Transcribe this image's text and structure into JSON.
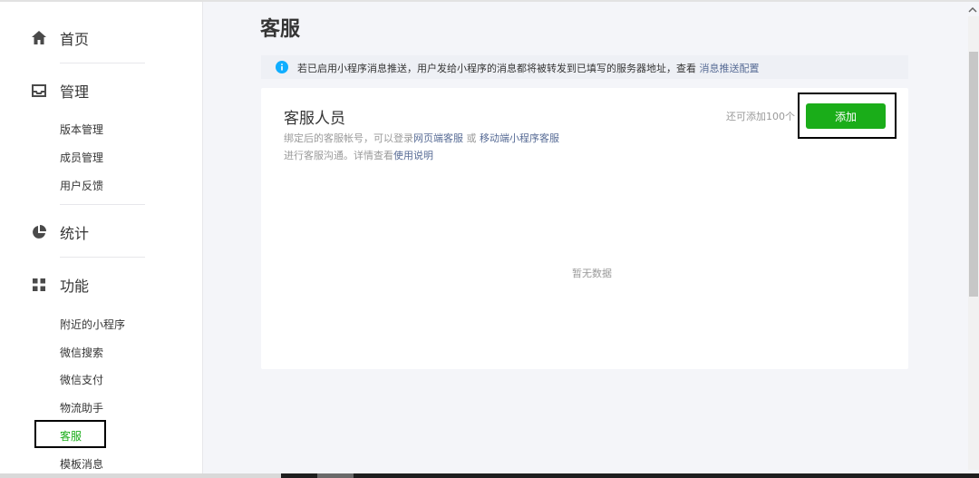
{
  "sidebar": {
    "home": {
      "label": "首页",
      "icon": "home-icon"
    },
    "manage": {
      "label": "管理",
      "icon": "inbox-icon",
      "items": [
        "版本管理",
        "成员管理",
        "用户反馈"
      ]
    },
    "stats": {
      "label": "统计",
      "icon": "pie-chart-icon"
    },
    "features": {
      "label": "功能",
      "icon": "grid-icon",
      "items": [
        "附近的小程序",
        "微信搜索",
        "微信支付",
        "物流助手",
        "客服",
        "模板消息"
      ],
      "active": "客服"
    }
  },
  "page": {
    "title": "客服"
  },
  "notice": {
    "text": "若已启用小程序消息推送，用户发给小程序的消息都将被转发到已填写的服务器地址，查看 ",
    "link": "消息推送配置"
  },
  "card": {
    "title": "客服人员",
    "desc_prefix": "绑定后的客服帐号，可以登录",
    "desc_link1": "网页端客服",
    "desc_or": " 或 ",
    "desc_link2": "移动端小程序客服",
    "desc_line2_prefix": "进行客服沟通。详情查看",
    "desc_line2_link": "使用说明",
    "quota": "还可添加100个",
    "add_button": "添加",
    "empty": "暂无数据"
  },
  "colors": {
    "accent": "#1aad19",
    "link": "#576b95",
    "info": "#10aeff"
  }
}
